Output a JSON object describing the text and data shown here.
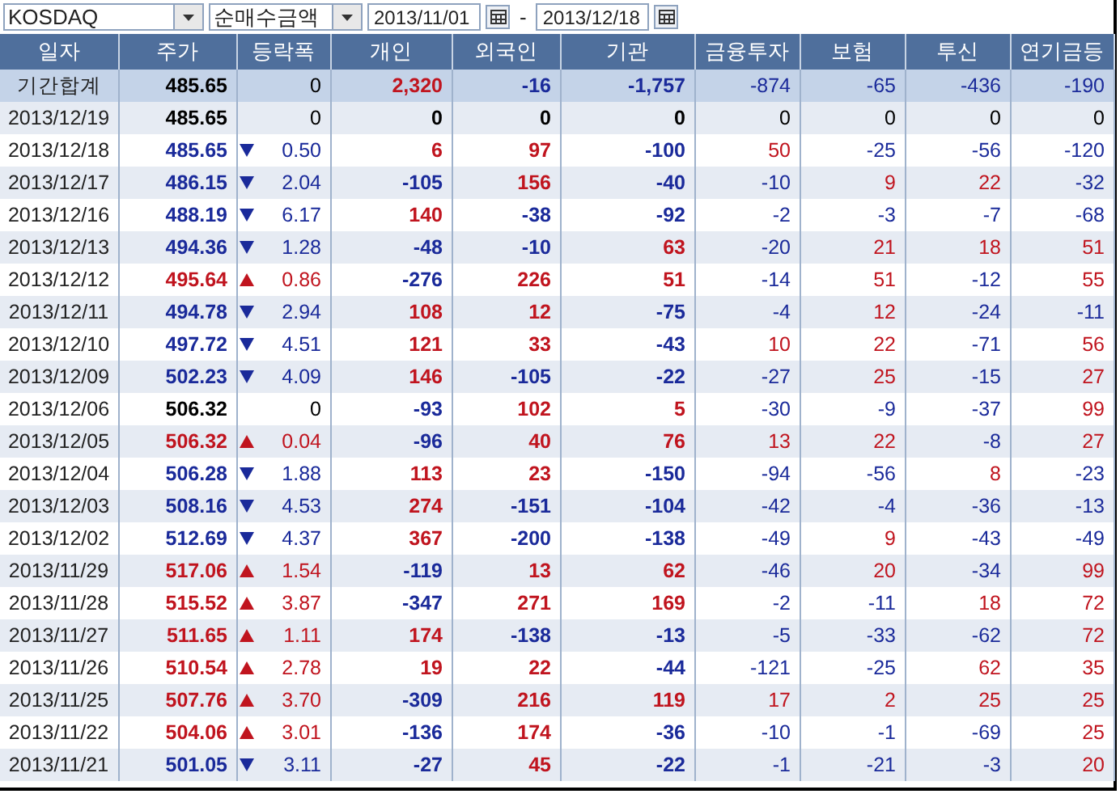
{
  "toolbar": {
    "market_select": "KOSDAQ",
    "metric_select": "순매수금액",
    "start_date": "2013/11/01",
    "date_separator": "-",
    "end_date": "2013/12/18"
  },
  "table": {
    "columns": [
      "일자",
      "주가",
      "등락폭",
      "개인",
      "외국인",
      "기관",
      "금융투자",
      "보험",
      "투신",
      "연기금등"
    ],
    "rows": [
      {
        "kind": "total",
        "up": false,
        "down": false,
        "cells": [
          "기간합계",
          "485.65",
          "0",
          "2,320",
          "-16",
          "-1,757",
          "-874",
          "-65",
          "-436",
          "-190"
        ]
      },
      {
        "kind": "day",
        "up": false,
        "down": false,
        "cells": [
          "2013/12/19",
          "485.65",
          "0",
          "0",
          "0",
          "0",
          "0",
          "0",
          "0",
          "0"
        ]
      },
      {
        "kind": "day",
        "up": false,
        "down": true,
        "cells": [
          "2013/12/18",
          "485.65",
          "0.50",
          "6",
          "97",
          "-100",
          "50",
          "-25",
          "-56",
          "-120"
        ]
      },
      {
        "kind": "day",
        "up": false,
        "down": true,
        "cells": [
          "2013/12/17",
          "486.15",
          "2.04",
          "-105",
          "156",
          "-40",
          "-10",
          "9",
          "22",
          "-32"
        ]
      },
      {
        "kind": "day",
        "up": false,
        "down": true,
        "cells": [
          "2013/12/16",
          "488.19",
          "6.17",
          "140",
          "-38",
          "-92",
          "-2",
          "-3",
          "-7",
          "-68"
        ]
      },
      {
        "kind": "day",
        "up": false,
        "down": true,
        "cells": [
          "2013/12/13",
          "494.36",
          "1.28",
          "-48",
          "-10",
          "63",
          "-20",
          "21",
          "18",
          "51"
        ]
      },
      {
        "kind": "day",
        "up": true,
        "down": false,
        "cells": [
          "2013/12/12",
          "495.64",
          "0.86",
          "-276",
          "226",
          "51",
          "-14",
          "51",
          "-12",
          "55"
        ]
      },
      {
        "kind": "day",
        "up": false,
        "down": true,
        "cells": [
          "2013/12/11",
          "494.78",
          "2.94",
          "108",
          "12",
          "-75",
          "-4",
          "12",
          "-24",
          "-11"
        ]
      },
      {
        "kind": "day",
        "up": false,
        "down": true,
        "cells": [
          "2013/12/10",
          "497.72",
          "4.51",
          "121",
          "33",
          "-43",
          "10",
          "22",
          "-71",
          "56"
        ]
      },
      {
        "kind": "day",
        "up": false,
        "down": true,
        "cells": [
          "2013/12/09",
          "502.23",
          "4.09",
          "146",
          "-105",
          "-22",
          "-27",
          "25",
          "-15",
          "27"
        ]
      },
      {
        "kind": "day",
        "up": false,
        "down": false,
        "cells": [
          "2013/12/06",
          "506.32",
          "0",
          "-93",
          "102",
          "5",
          "-30",
          "-9",
          "-37",
          "99"
        ]
      },
      {
        "kind": "day",
        "up": true,
        "down": false,
        "cells": [
          "2013/12/05",
          "506.32",
          "0.04",
          "-96",
          "40",
          "76",
          "13",
          "22",
          "-8",
          "27"
        ]
      },
      {
        "kind": "day",
        "up": false,
        "down": true,
        "cells": [
          "2013/12/04",
          "506.28",
          "1.88",
          "113",
          "23",
          "-150",
          "-94",
          "-56",
          "8",
          "-23"
        ]
      },
      {
        "kind": "day",
        "up": false,
        "down": true,
        "cells": [
          "2013/12/03",
          "508.16",
          "4.53",
          "274",
          "-151",
          "-104",
          "-42",
          "-4",
          "-36",
          "-13"
        ]
      },
      {
        "kind": "day",
        "up": false,
        "down": true,
        "cells": [
          "2013/12/02",
          "512.69",
          "4.37",
          "367",
          "-200",
          "-138",
          "-49",
          "9",
          "-43",
          "-49"
        ]
      },
      {
        "kind": "day",
        "up": true,
        "down": false,
        "cells": [
          "2013/11/29",
          "517.06",
          "1.54",
          "-119",
          "13",
          "62",
          "-46",
          "20",
          "-34",
          "99"
        ]
      },
      {
        "kind": "day",
        "up": true,
        "down": false,
        "cells": [
          "2013/11/28",
          "515.52",
          "3.87",
          "-347",
          "271",
          "169",
          "-2",
          "-11",
          "18",
          "72"
        ]
      },
      {
        "kind": "day",
        "up": true,
        "down": false,
        "cells": [
          "2013/11/27",
          "511.65",
          "1.11",
          "174",
          "-138",
          "-13",
          "-5",
          "-33",
          "-62",
          "72"
        ]
      },
      {
        "kind": "day",
        "up": true,
        "down": false,
        "cells": [
          "2013/11/26",
          "510.54",
          "2.78",
          "19",
          "22",
          "-44",
          "-121",
          "-25",
          "62",
          "35"
        ]
      },
      {
        "kind": "day",
        "up": true,
        "down": false,
        "cells": [
          "2013/11/25",
          "507.76",
          "3.70",
          "-309",
          "216",
          "119",
          "17",
          "2",
          "25",
          "25"
        ]
      },
      {
        "kind": "day",
        "up": true,
        "down": false,
        "cells": [
          "2013/11/22",
          "504.06",
          "3.01",
          "-136",
          "174",
          "-36",
          "-10",
          "-1",
          "-69",
          "25"
        ]
      },
      {
        "kind": "day",
        "up": false,
        "down": true,
        "cells": [
          "2013/11/21",
          "501.05",
          "3.11",
          "-27",
          "45",
          "-22",
          "-1",
          "-21",
          "-3",
          "20"
        ]
      }
    ]
  }
}
